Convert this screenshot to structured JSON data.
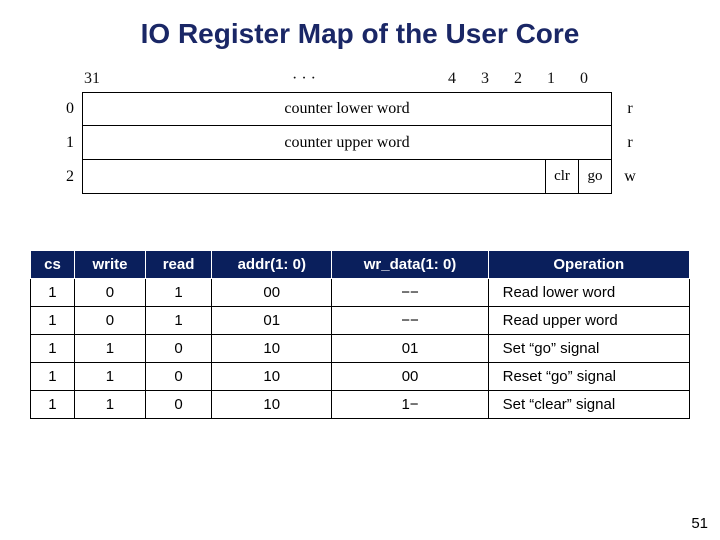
{
  "title": "IO Register Map of the User Core",
  "diagram": {
    "bits": {
      "b31": "31",
      "dots": "· · ·",
      "b4": "4",
      "b3": "3",
      "b2": "2",
      "b1": "1",
      "b0": "0"
    },
    "rows": [
      {
        "index": "0",
        "label": "counter lower word",
        "mode": "r"
      },
      {
        "index": "1",
        "label": "counter upper word",
        "mode": "r"
      },
      {
        "index": "2",
        "cells": {
          "clr": "clr",
          "go": "go"
        },
        "mode": "w"
      }
    ]
  },
  "table": {
    "headers": {
      "cs": "cs",
      "write": "write",
      "read": "read",
      "addr": "addr(1: 0)",
      "wrdata": "wr_data(1: 0)",
      "op": "Operation"
    },
    "rows": [
      {
        "cs": "1",
        "write": "0",
        "read": "1",
        "addr": "00",
        "wrdata": "−−",
        "op": "Read lower word"
      },
      {
        "cs": "1",
        "write": "0",
        "read": "1",
        "addr": "01",
        "wrdata": "−−",
        "op": "Read upper word"
      },
      {
        "cs": "1",
        "write": "1",
        "read": "0",
        "addr": "10",
        "wrdata": "01",
        "op": "Set “go” signal"
      },
      {
        "cs": "1",
        "write": "1",
        "read": "0",
        "addr": "10",
        "wrdata": "00",
        "op": "Reset “go” signal"
      },
      {
        "cs": "1",
        "write": "1",
        "read": "0",
        "addr": "10",
        "wrdata": "1−",
        "op": "Set “clear” signal"
      }
    ]
  },
  "page_number": "51"
}
